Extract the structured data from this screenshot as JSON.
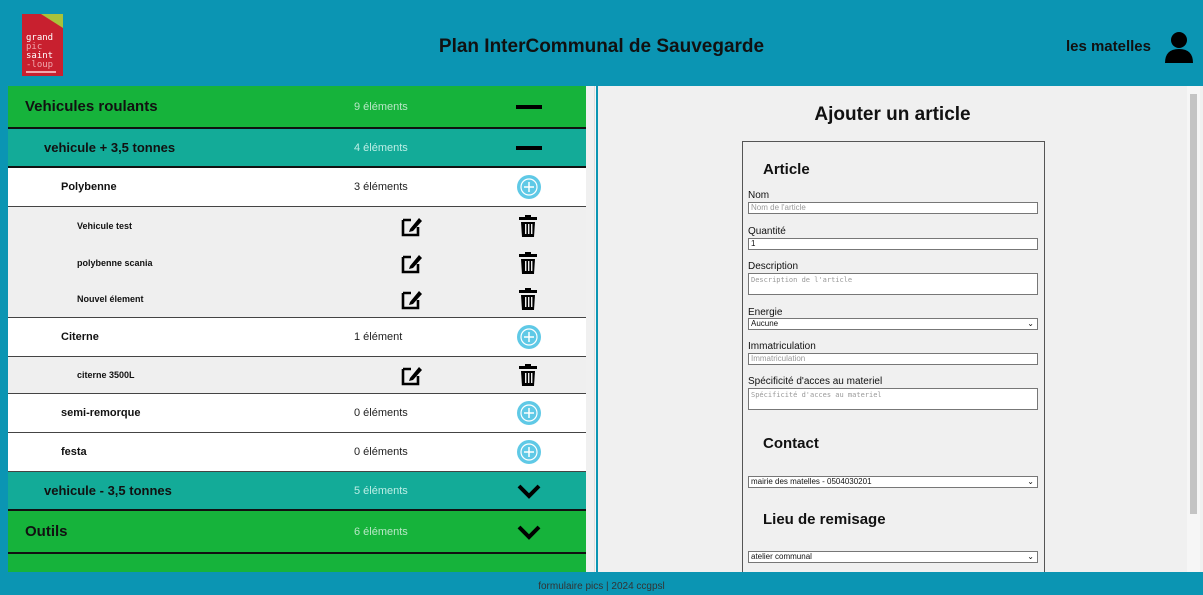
{
  "header": {
    "logo_lines": [
      "grand",
      "pic",
      "saint",
      "-loup"
    ],
    "title": "Plan InterCommunal de Sauvegarde",
    "user_name": "les matelles"
  },
  "tree": [
    {
      "level": 0,
      "label": "Vehicules roulants",
      "count": "9 éléments",
      "control": "minus"
    },
    {
      "level": 1,
      "label": "vehicule + 3,5 tonnes",
      "count": "4 éléments",
      "control": "minus"
    },
    {
      "level": 2,
      "label": "Polybenne",
      "count": "3 éléments",
      "control": "plus"
    },
    {
      "level": 3,
      "label": "Vehicule test",
      "control": "item"
    },
    {
      "level": 3,
      "label": "polybenne scania",
      "control": "item"
    },
    {
      "level": 3,
      "label": "Nouvel élement",
      "control": "item",
      "last": true
    },
    {
      "level": 2,
      "label": "Citerne",
      "count": "1 élément",
      "control": "plus"
    },
    {
      "level": 3,
      "label": "citerne 3500L",
      "control": "item",
      "last": true
    },
    {
      "level": 2,
      "label": "semi-remorque",
      "count": "0 éléments",
      "control": "plus"
    },
    {
      "level": 2,
      "label": "festa",
      "count": "0 éléments",
      "control": "plus"
    },
    {
      "level": 1,
      "label": "vehicule - 3,5 tonnes",
      "count": "5 éléments",
      "control": "chevron"
    },
    {
      "level": 0,
      "label": "Outils",
      "count": "6 éléments",
      "control": "chevron"
    },
    {
      "level": 0,
      "label": "",
      "count": "",
      "control": "none"
    }
  ],
  "form": {
    "title": "Ajouter un article",
    "section_article": "Article",
    "nom_label": "Nom",
    "nom_placeholder": "Nom de l'article",
    "quantite_label": "Quantité",
    "quantite_value": "1",
    "description_label": "Description",
    "description_placeholder": "Description de l'article",
    "energie_label": "Energie",
    "energie_value": "Aucune",
    "immat_label": "Immatriculation",
    "immat_placeholder": "Immatriculation",
    "acces_label": "Spécificité d'acces au materiel",
    "acces_placeholder": "Spécificité d'acces au materiel",
    "section_contact": "Contact",
    "contact_value": "mairie des matelles - 0504030201",
    "section_remisage": "Lieu de remisage",
    "remisage_value": "atelier communal"
  },
  "footer": {
    "text": "formulaire pics | 2024 ccgpsl"
  },
  "colors": {
    "header_bg": "#0b95b3",
    "category_bg": "#16b33b",
    "subcategory_bg": "#13ab98",
    "plus_circle": "#5fc9e6",
    "logo_red": "#c8202f"
  }
}
